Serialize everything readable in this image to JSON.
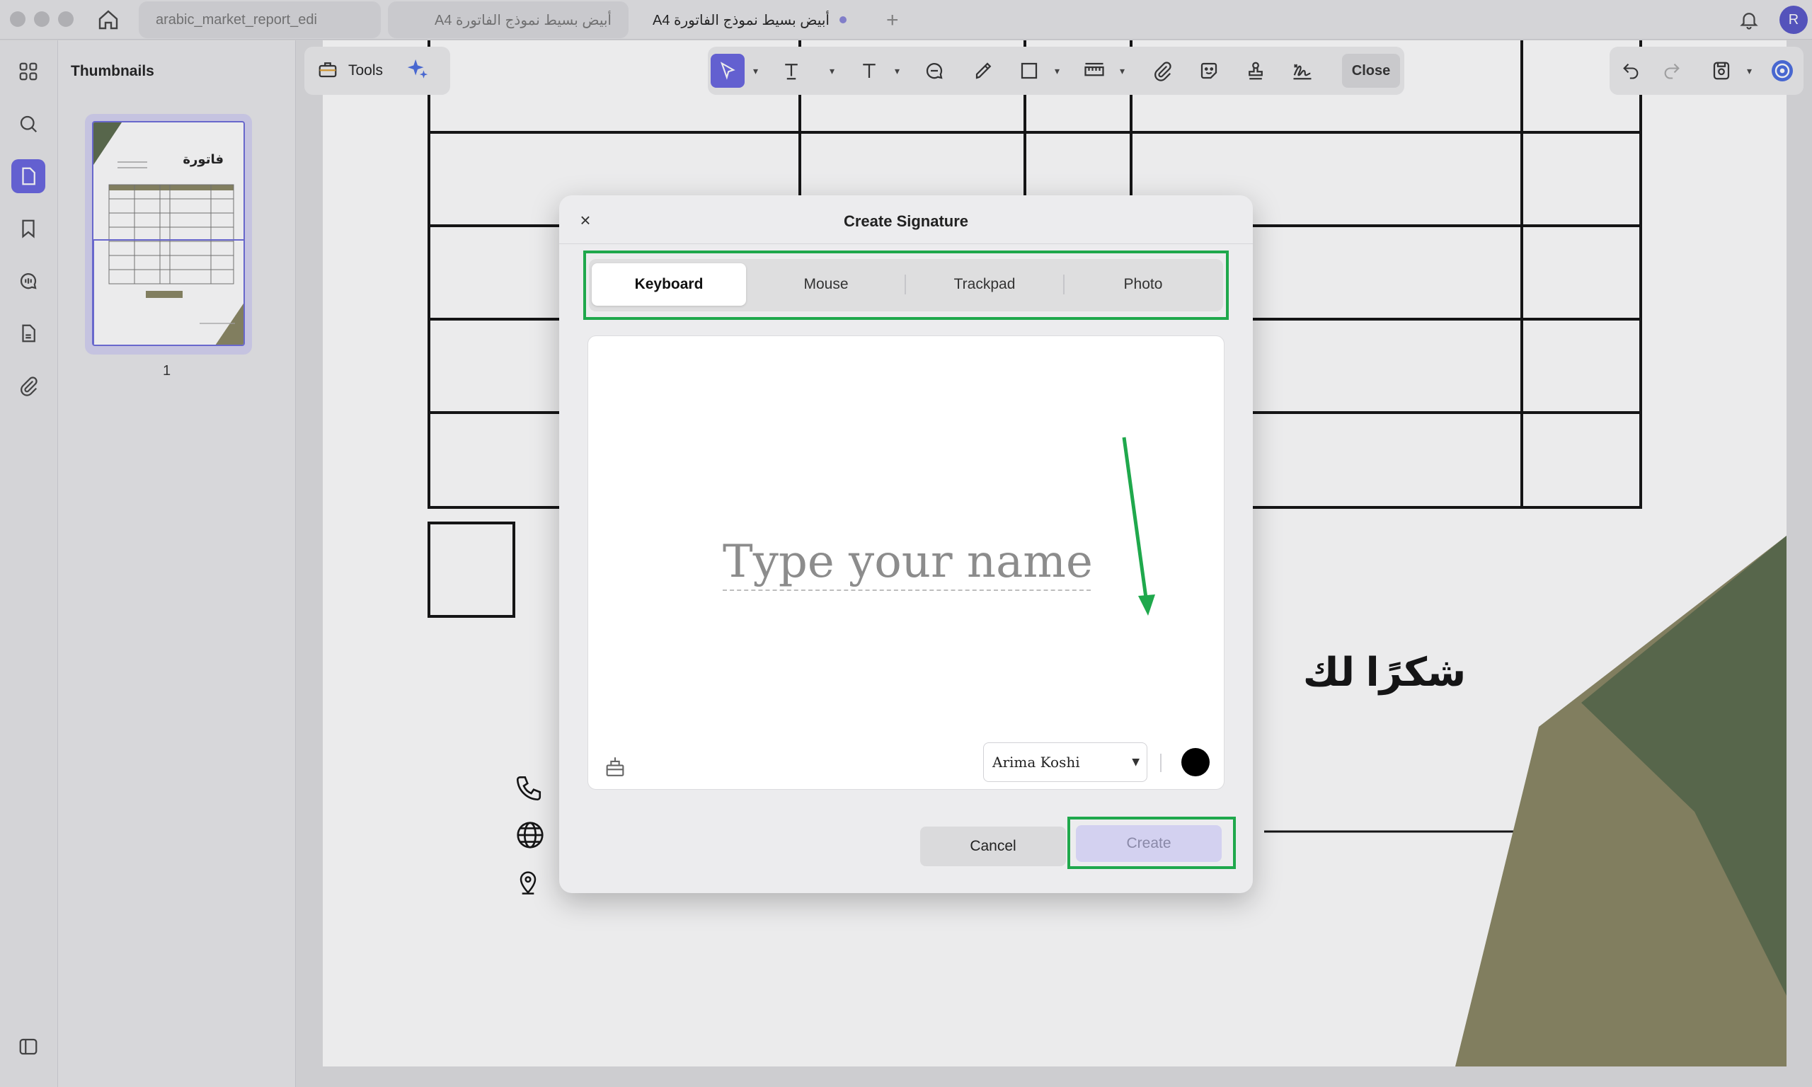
{
  "tabs": [
    {
      "label": "arabic_market_report_edi"
    },
    {
      "label": "أبيض بسيط نموذج الفاتورة A4"
    },
    {
      "label": "أبيض بسيط نموذج الفاتورة A4"
    }
  ],
  "user": {
    "initial": "R"
  },
  "thumbnails": {
    "title": "Thumbnails",
    "page_number": "1",
    "preview_heading": "فاتورة"
  },
  "toolbar": {
    "tools_label": "Tools",
    "close_label": "Close"
  },
  "document": {
    "thanks_text": "شكرًا لك"
  },
  "modal": {
    "title": "Create Signature",
    "close_symbol": "×",
    "tabs": [
      {
        "label": "Keyboard"
      },
      {
        "label": "Mouse"
      },
      {
        "label": "Trackpad"
      },
      {
        "label": "Photo"
      }
    ],
    "input_placeholder": "Type your name",
    "font_name": "Arima Koshi",
    "signature_color": "#000000",
    "cancel_label": "Cancel",
    "create_label": "Create"
  },
  "colors": {
    "accent": "#6865e0",
    "highlight": "#1fa84c",
    "olive_dark": "#5b6b4c",
    "olive_light": "#8a8663"
  }
}
